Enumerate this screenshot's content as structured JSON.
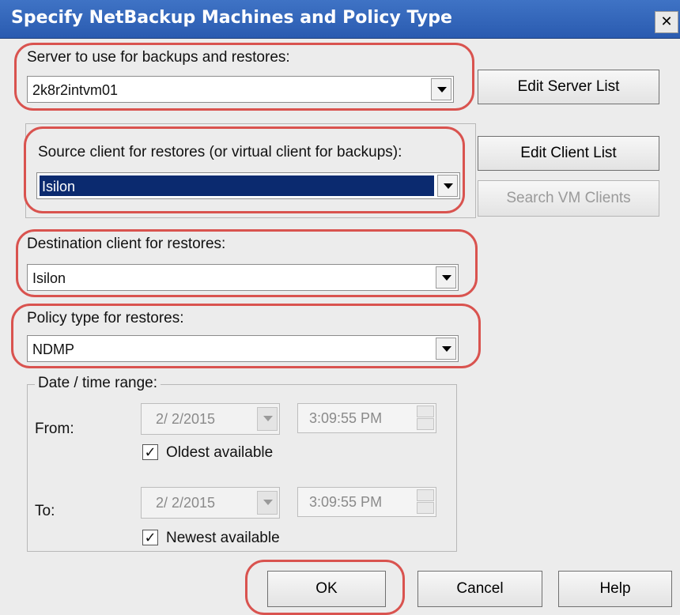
{
  "window": {
    "title": "Specify NetBackup Machines and Policy Type",
    "close_glyph": "✕"
  },
  "server": {
    "label": "Server to use for backups and restores:",
    "value": "2k8r2intvm01",
    "edit_button": "Edit Server List"
  },
  "source": {
    "label": "Source client for restores (or virtual client for backups):",
    "value": "Isilon",
    "edit_button": "Edit Client List",
    "search_button": "Search VM Clients"
  },
  "destination": {
    "label": "Destination client for restores:",
    "value": "Isilon"
  },
  "policy": {
    "label": "Policy type for restores:",
    "value": "NDMP"
  },
  "date_range": {
    "legend": "Date / time range:",
    "from": {
      "label": "From:",
      "date": "2/ 2/2015",
      "time": "3:09:55 PM",
      "checkbox_label": "Oldest available",
      "checked": true
    },
    "to": {
      "label": "To:",
      "date": "2/ 2/2015",
      "time": "3:09:55 PM",
      "checkbox_label": "Newest available",
      "checked": true
    }
  },
  "footer": {
    "ok": "OK",
    "cancel": "Cancel",
    "help": "Help"
  },
  "colors": {
    "accent": "#2a5bb0",
    "highlight": "#0b2a6f",
    "annotation": "#d9534f"
  },
  "check_glyph": "✓"
}
